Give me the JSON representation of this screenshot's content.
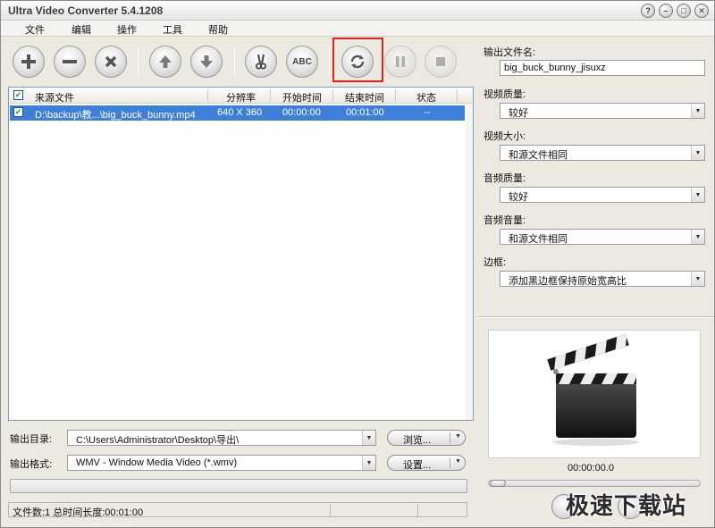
{
  "window": {
    "title": "Ultra Video Converter 5.4.1208"
  },
  "menu": [
    "文件",
    "编辑",
    "操作",
    "工具",
    "帮助"
  ],
  "toolbar": {
    "buttons": [
      {
        "name": "add-icon",
        "state": "enabled"
      },
      {
        "name": "remove-icon",
        "state": "enabled"
      },
      {
        "name": "clear-icon",
        "state": "enabled"
      },
      {
        "name": "move-up-icon",
        "state": "enabled"
      },
      {
        "name": "move-down-icon",
        "state": "enabled"
      },
      {
        "name": "cut-icon",
        "state": "enabled"
      },
      {
        "name": "abc-icon",
        "label": "ABC",
        "state": "enabled"
      },
      {
        "name": "convert-icon",
        "state": "enabled",
        "highlighted": true
      },
      {
        "name": "pause-icon",
        "state": "disabled"
      },
      {
        "name": "stop-icon",
        "state": "disabled"
      }
    ],
    "highlight_color": "#e0241c"
  },
  "file_list": {
    "columns": [
      "来源文件",
      "分辨率",
      "开始时间",
      "结束时间",
      "状态"
    ],
    "rows": [
      {
        "checked": true,
        "source": "D:\\backup\\教...\\big_buck_bunny.mp4",
        "resolution": "640 X 360",
        "start": "00:00:00",
        "end": "00:01:00",
        "status": "--"
      }
    ],
    "selected_color": "#3d7fd9"
  },
  "output": {
    "dir_label": "输出目录:",
    "dir_value": "C:\\Users\\Administrator\\Desktop\\导出\\",
    "browse_label": "浏览...",
    "format_label": "输出格式:",
    "format_value": "WMV - Window Media Video (*.wmv)",
    "settings_label": "设置..."
  },
  "status": {
    "text": "文件数:1  总时间长度:00:01:00"
  },
  "settings": {
    "filename_label": "输出文件名:",
    "filename_value": "big_buck_bunny_jisuxz",
    "video_quality_label": "视频质量:",
    "video_quality_value": "较好",
    "video_size_label": "视频大小:",
    "video_size_value": "和源文件相同",
    "audio_quality_label": "音频质量:",
    "audio_quality_value": "较好",
    "audio_volume_label": "音频音量:",
    "audio_volume_value": "和源文件相同",
    "border_label": "边框:",
    "border_value": "添加黑边框保持原始宽高比"
  },
  "preview": {
    "icon": "clapperboard-icon",
    "timecode": "00:00:00.0",
    "position": 0
  },
  "watermark": "极速下载站"
}
